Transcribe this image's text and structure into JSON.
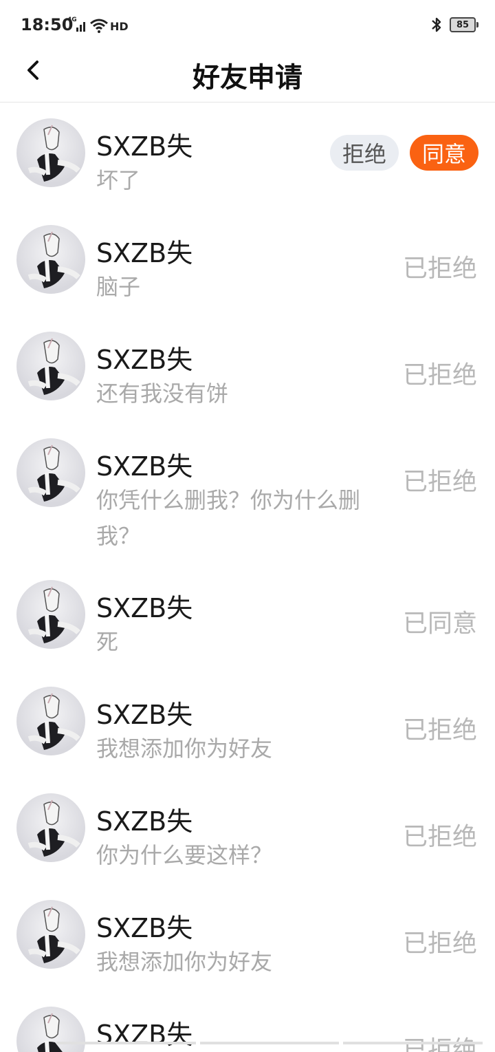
{
  "status_bar": {
    "time": "18:50",
    "network": "4G",
    "hd": "HD",
    "battery": "85"
  },
  "header": {
    "title": "好友申请"
  },
  "requests": [
    {
      "name": "SXZB失",
      "message": "坏了",
      "state": "pending",
      "reject_label": "拒绝",
      "accept_label": "同意"
    },
    {
      "name": "SXZB失",
      "message": "脑子",
      "state": "done",
      "status": "已拒绝"
    },
    {
      "name": "SXZB失",
      "message": "还有我没有饼",
      "state": "done",
      "status": "已拒绝"
    },
    {
      "name": "SXZB失",
      "message": "你凭什么删我？你为什么删我？",
      "state": "done",
      "status": "已拒绝"
    },
    {
      "name": "SXZB失",
      "message": "死",
      "state": "done",
      "status": "已同意"
    },
    {
      "name": "SXZB失",
      "message": "我想添加你为好友",
      "state": "done",
      "status": "已拒绝"
    },
    {
      "name": "SXZB失",
      "message": "你为什么要这样？",
      "state": "done",
      "status": "已拒绝"
    },
    {
      "name": "SXZB失",
      "message": "我想添加你为好友",
      "state": "done",
      "status": "已拒绝"
    },
    {
      "name": "SXZB失",
      "message": "",
      "state": "done",
      "status": "已拒绝"
    }
  ],
  "colors": {
    "accent": "#fa6212",
    "reject_bg": "#eaedf2",
    "muted_text": "#a9a9a9",
    "status_text": "#b8b8b8"
  },
  "icons": {
    "back": "chevron-left-icon",
    "avatar": "avatar-illustration"
  }
}
